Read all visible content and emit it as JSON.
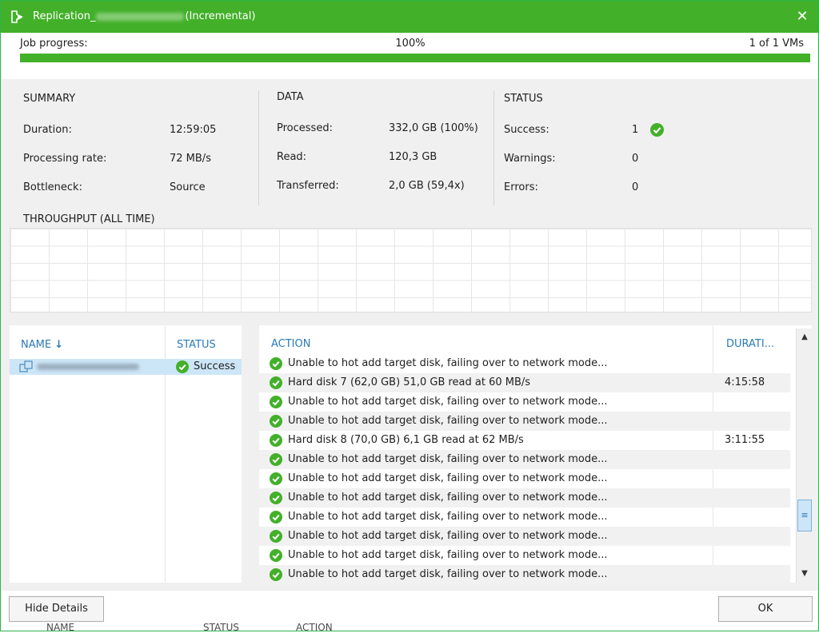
{
  "window": {
    "title_prefix": "Replication_",
    "title_suffix": "(Incremental)"
  },
  "progress": {
    "label": "Job progress:",
    "percent_text": "100%",
    "vms_text": "1 of 1 VMs",
    "fraction": 1.0
  },
  "summary": {
    "title": "SUMMARY",
    "duration_label": "Duration:",
    "duration_value": "12:59:05",
    "rate_label": "Processing rate:",
    "rate_value": "72 MB/s",
    "bottleneck_label": "Bottleneck:",
    "bottleneck_value": "Source"
  },
  "data": {
    "title": "DATA",
    "processed_label": "Processed:",
    "processed_value": "332,0 GB (100%)",
    "read_label": "Read:",
    "read_value": "120,3 GB",
    "transferred_label": "Transferred:",
    "transferred_value": "2,0 GB (59,4x)"
  },
  "status": {
    "title": "STATUS",
    "success_label": "Success:",
    "success_value": "1",
    "warnings_label": "Warnings:",
    "warnings_value": "0",
    "errors_label": "Errors:",
    "errors_value": "0"
  },
  "throughput": {
    "title": "THROUGHPUT (ALL TIME)"
  },
  "vm_list": {
    "name_header": "NAME",
    "status_header": "STATUS",
    "selected_status": "Success"
  },
  "actions": {
    "action_header": "ACTION",
    "duration_header": "DURATI...",
    "rows": [
      {
        "text": "Unable to hot add target disk, failing over to network mode...",
        "duration": ""
      },
      {
        "text": "Hard disk 7 (62,0 GB) 51,0 GB read at 60 MB/s",
        "duration": "4:15:58"
      },
      {
        "text": "Unable to hot add target disk, failing over to network mode...",
        "duration": ""
      },
      {
        "text": "Unable to hot add target disk, failing over to network mode...",
        "duration": ""
      },
      {
        "text": "Hard disk 8 (70,0 GB) 6,1 GB read at 62 MB/s",
        "duration": "3:11:55"
      },
      {
        "text": "Unable to hot add target disk, failing over to network mode...",
        "duration": ""
      },
      {
        "text": "Unable to hot add target disk, failing over to network mode...",
        "duration": ""
      },
      {
        "text": "Unable to hot add target disk, failing over to network mode...",
        "duration": ""
      },
      {
        "text": "Unable to hot add target disk, failing over to network mode...",
        "duration": ""
      },
      {
        "text": "Unable to hot add target disk, failing over to network mode...",
        "duration": ""
      },
      {
        "text": "Unable to hot add target disk, failing over to network mode...",
        "duration": ""
      },
      {
        "text": "Unable to hot add target disk, failing over to network mode...",
        "duration": ""
      }
    ]
  },
  "buttons": {
    "hide_details": "Hide Details",
    "ok": "OK"
  },
  "background_window": {
    "name_header": "NAME",
    "status_header": "STATUS",
    "action_header": "ACTION"
  },
  "colors": {
    "accent_green": "#43b02a",
    "link_blue": "#2a7ab8",
    "selection_blue": "#cde6f7"
  }
}
